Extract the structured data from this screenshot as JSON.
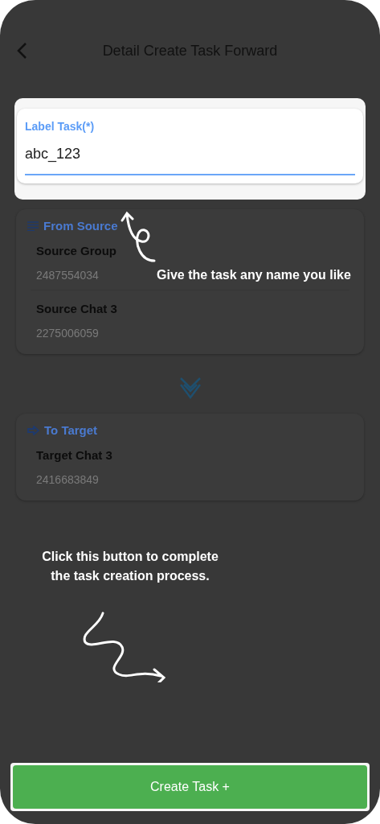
{
  "header": {
    "title": "Detail Create Task Forward"
  },
  "label_field": {
    "label": "Label Task(*)",
    "value": "abc_123"
  },
  "source": {
    "title": "From Source",
    "items": [
      {
        "name": "Source Group",
        "id": "2487554034"
      },
      {
        "name": "Source Chat 3",
        "id": "2275006059"
      }
    ]
  },
  "target": {
    "title": "To Target",
    "items": [
      {
        "name": "Target Chat 3",
        "id": "2416683849"
      }
    ]
  },
  "tips": [
    "Give the task any name you like",
    "Click this button to complete the task creation process."
  ],
  "create_button": {
    "label": "Create Task +"
  }
}
